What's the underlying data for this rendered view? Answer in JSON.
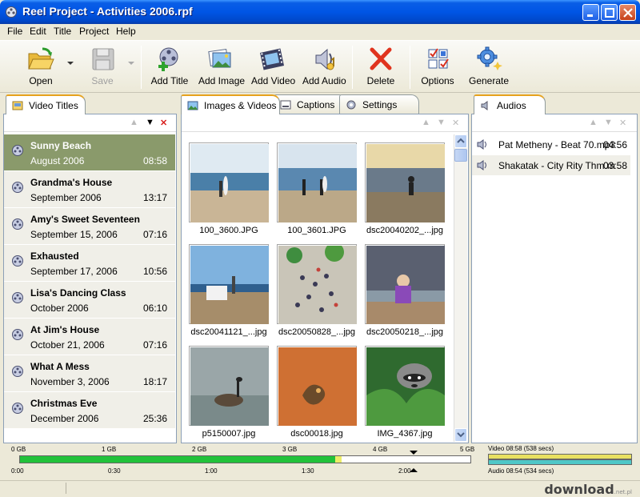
{
  "window": {
    "title": "Reel Project - Activities 2006.rpf"
  },
  "menu": [
    "File",
    "Edit",
    "Title",
    "Project",
    "Help"
  ],
  "toolbar": {
    "open": "Open",
    "save": "Save",
    "add_title": "Add Title",
    "add_image": "Add Image",
    "add_video": "Add Video",
    "add_audio": "Add Audio",
    "delete": "Delete",
    "options": "Options",
    "generate": "Generate"
  },
  "tabs": {
    "video_titles": "Video Titles",
    "images_videos": "Images & Videos",
    "captions": "Captions",
    "settings": "Settings",
    "audios": "Audios"
  },
  "video_titles": [
    {
      "name": "Sunny Beach",
      "date": "August 2006",
      "duration": "08:58",
      "selected": true
    },
    {
      "name": "Grandma's House",
      "date": "September 2006",
      "duration": "13:17"
    },
    {
      "name": "Amy's Sweet Seventeen",
      "date": "September 15, 2006",
      "duration": "07:16"
    },
    {
      "name": "Exhausted",
      "date": "September 17, 2006",
      "duration": "10:56"
    },
    {
      "name": "Lisa's Dancing Class",
      "date": "October 2006",
      "duration": "06:10"
    },
    {
      "name": "At Jim's House",
      "date": "October 21, 2006",
      "duration": "07:16"
    },
    {
      "name": "What A Mess",
      "date": "November 3, 2006",
      "duration": "18:17"
    },
    {
      "name": "Christmas Eve",
      "date": "December 2006",
      "duration": "25:36"
    }
  ],
  "images": [
    "100_3600.JPG",
    "100_3601.JPG",
    "dsc20040202_...jpg",
    "dsc20041121_...jpg",
    "dsc20050828_...jpg",
    "dsc20050218_...jpg",
    "p5150007.jpg",
    "dsc00018.jpg",
    "IMG_4367.jpg"
  ],
  "audios": [
    {
      "name": "Pat Metheny - Beat 70.mp3",
      "duration": "04:56"
    },
    {
      "name": "Shakatak - City Rity Thm.m",
      "duration": "03:58"
    }
  ],
  "capacity": {
    "gb_labels": [
      "0 GB",
      "1 GB",
      "2 GB",
      "3 GB",
      "4 GB",
      "5 GB"
    ],
    "time_labels": [
      "0:00",
      "0:30",
      "1:00",
      "1:30",
      "2:00"
    ],
    "video_label": "Video 08:58 (538 secs)",
    "audio_label": "Audio 08:54 (534 secs)",
    "used_fraction": 0.7,
    "colors": {
      "used": "#22c23a",
      "free": "#eded6a",
      "video_bar": "#e8e060",
      "audio_bar": "#4fc7c7"
    }
  },
  "watermark": {
    "text": "download",
    "sub": ".net.pl"
  },
  "colors": {
    "selected_row": "#8a9a6b",
    "titlebar": "#0055e5",
    "tab_accent": "#e6a21d"
  }
}
